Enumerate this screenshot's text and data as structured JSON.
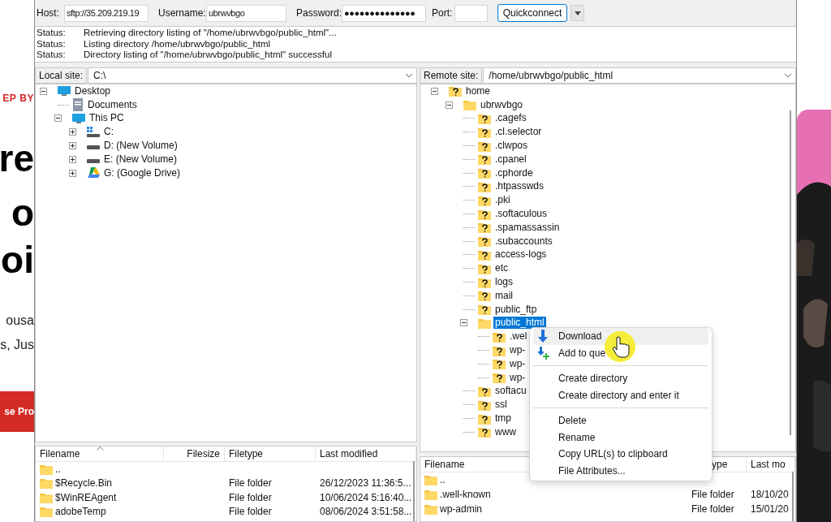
{
  "background_page": {
    "texts": [
      {
        "kind": "tagline",
        "text": "EP BY"
      },
      {
        "kind": "heading",
        "text": "re"
      },
      {
        "kind": "heading",
        "text": "o"
      },
      {
        "kind": "heading",
        "text": "oi"
      },
      {
        "kind": "body",
        "text": "ousa"
      },
      {
        "kind": "body",
        "text": "s, Jus"
      },
      {
        "kind": "button",
        "text": "se Pro"
      }
    ]
  },
  "quickconnect": {
    "fields": [
      {
        "label": "Host:",
        "value": "sftp://35.209.219.19"
      },
      {
        "label": "Username:",
        "value": "ubrwvbgo"
      },
      {
        "label": "Password:",
        "value": "●●●●●●●●●●●●●●"
      },
      {
        "label": "Port:"
      }
    ],
    "button": "Quickconnect"
  },
  "message_log": [
    {
      "label": "Status:",
      "text": "Retrieving directory listing of \"/home/ubrwvbgo/public_html\"..."
    },
    {
      "label": "Status:",
      "text": "Listing directory /home/ubrwvbgo/public_html"
    },
    {
      "label": "Status:",
      "text": "Directory listing of \"/home/ubrwvbgo/public_html\" successful"
    }
  ],
  "local_site": {
    "label": "Local site:",
    "path": "C:\\",
    "tree": [
      {
        "name": "Desktop",
        "kind": "desktop",
        "expanded": true,
        "selected": false,
        "children": [
          {
            "name": "Documents",
            "kind": "documents",
            "selected": false
          },
          {
            "name": "This PC",
            "kind": "computer",
            "expanded": true,
            "selected": false,
            "children": [
              {
                "name": "C:",
                "kind": "windows-drive",
                "expanded": false,
                "selected": false
              },
              {
                "name": "D: (New Volume)",
                "kind": "drive",
                "expanded": false,
                "selected": false
              },
              {
                "name": "E: (New Volume)",
                "kind": "drive",
                "expanded": false,
                "selected": false
              },
              {
                "name": "G: (Google Drive)",
                "kind": "cloud-drive",
                "expanded": false,
                "selected": false
              }
            ]
          }
        ]
      }
    ]
  },
  "remote_site": {
    "label": "Remote site:",
    "path": "/home/ubrwvbgo/public_html",
    "tree": [
      {
        "name": "home",
        "kind": "unknown-folder",
        "expanded": true,
        "selected": false,
        "children": [
          {
            "name": "ubrwvbgo",
            "kind": "folder",
            "expanded": true,
            "selected": false,
            "children": [
              {
                "name": ".cagefs",
                "kind": "unknown-folder",
                "selected": false
              },
              {
                "name": ".cl.selector",
                "kind": "unknown-folder",
                "selected": false
              },
              {
                "name": ".clwpos",
                "kind": "unknown-folder",
                "selected": false
              },
              {
                "name": ".cpanel",
                "kind": "unknown-folder",
                "selected": false
              },
              {
                "name": ".cphorde",
                "kind": "unknown-folder",
                "selected": false
              },
              {
                "name": ".htpasswds",
                "kind": "unknown-folder",
                "selected": false
              },
              {
                "name": ".pki",
                "kind": "unknown-folder",
                "selected": false
              },
              {
                "name": ".softaculous",
                "kind": "unknown-folder",
                "selected": false
              },
              {
                "name": ".spamassassin",
                "kind": "unknown-folder",
                "selected": false
              },
              {
                "name": ".subaccounts",
                "kind": "unknown-folder",
                "selected": false
              },
              {
                "name": "access-logs",
                "kind": "unknown-folder",
                "selected": false
              },
              {
                "name": "etc",
                "kind": "unknown-folder",
                "selected": false
              },
              {
                "name": "logs",
                "kind": "unknown-folder",
                "selected": false
              },
              {
                "name": "mail",
                "kind": "unknown-folder",
                "selected": false
              },
              {
                "name": "public_ftp",
                "kind": "unknown-folder",
                "selected": false
              },
              {
                "name": "public_html",
                "kind": "folder",
                "expanded": true,
                "selected": true,
                "children": [
                  {
                    "name": ".wel",
                    "kind": "unknown-folder",
                    "selected": false
                  },
                  {
                    "name": "wp-",
                    "kind": "unknown-folder",
                    "selected": false
                  },
                  {
                    "name": "wp-",
                    "kind": "unknown-folder",
                    "selected": false
                  },
                  {
                    "name": "wp-",
                    "kind": "unknown-folder",
                    "selected": false
                  }
                ]
              },
              {
                "name": "softacu",
                "kind": "unknown-folder",
                "selected": false
              },
              {
                "name": "ssl",
                "kind": "unknown-folder",
                "selected": false
              },
              {
                "name": "tmp",
                "kind": "unknown-folder",
                "selected": false
              },
              {
                "name": "www",
                "kind": "unknown-folder",
                "selected": false
              }
            ]
          }
        ]
      }
    ]
  },
  "local_files": {
    "columns": [
      {
        "label": "Filename",
        "sorted": true
      },
      {
        "label": "Filesize",
        "sorted": false
      },
      {
        "label": "Filetype",
        "sorted": false
      },
      {
        "label": "Last modified",
        "sorted": false
      }
    ],
    "rows": [
      {
        "name": ".."
      },
      {
        "name": "$Recycle.Bin",
        "type": "File folder",
        "modified": "26/12/2023 11:36:5..."
      },
      {
        "name": "$WinREAgent",
        "type": "File folder",
        "modified": "10/06/2024 5:16:40..."
      },
      {
        "name": "adobeTemp",
        "type": "File folder",
        "modified": "08/06/2024 3:51:58..."
      }
    ]
  },
  "remote_files": {
    "columns": [
      {
        "label": "Filename",
        "sorted": false
      },
      {
        "label": "ype",
        "sorted": false
      },
      {
        "label": "Last mo",
        "sorted": false
      }
    ],
    "rows": [
      {
        "name": ".."
      },
      {
        "name": ".well-known",
        "type": "File folder",
        "modified": "18/10/20"
      },
      {
        "name": "wp-admin",
        "type": "File folder",
        "modified": "15/01/20"
      }
    ]
  },
  "context_menu": {
    "items": [
      {
        "kind": "item",
        "label": "Download",
        "highlighted": true
      },
      {
        "kind": "item",
        "label": "Add to que",
        "highlighted": false
      },
      {
        "kind": "separator"
      },
      {
        "kind": "item",
        "label": "Create directory",
        "highlighted": false
      },
      {
        "kind": "item",
        "label": "Create directory and enter it",
        "highlighted": false
      },
      {
        "kind": "separator"
      },
      {
        "kind": "item",
        "label": "Delete",
        "highlighted": false
      },
      {
        "kind": "item",
        "label": "Rename",
        "highlighted": false
      },
      {
        "kind": "item",
        "label": "Copy URL(s) to clipboard",
        "highlighted": false
      },
      {
        "kind": "item",
        "label": "File Attributes...",
        "highlighted": false
      }
    ]
  }
}
